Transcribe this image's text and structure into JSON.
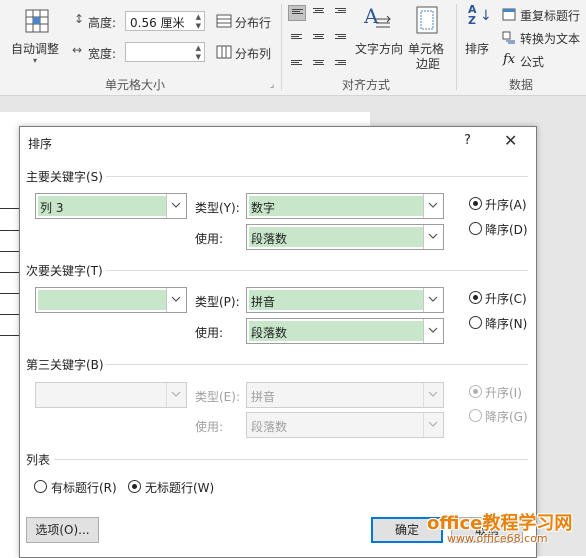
{
  "ribbon": {
    "autofit_label": "自动调整",
    "height_label": "高度:",
    "height_value": "0.56 厘米",
    "width_label": "宽度:",
    "width_value": "",
    "distribute_rows": "分布行",
    "distribute_cols": "分布列",
    "cell_size_group": "单元格大小",
    "text_direction": "文字方向",
    "cell_margins_line1": "单元格",
    "cell_margins_line2": "边距",
    "align_group": "对齐方式",
    "sort_label": "排序",
    "repeat_header": "重复标题行",
    "convert_to_text": "转换为文本",
    "formula_label": "公式",
    "data_group": "数据"
  },
  "dialog": {
    "title": "排序",
    "help": "?",
    "close": "✕",
    "primary": {
      "section": "主要关键字(S)",
      "column": "列 3",
      "type_label": "类型(Y):",
      "type_value": "数字",
      "using_label": "使用:",
      "using_value": "段落数",
      "asc": "升序(A)",
      "desc": "降序(D)",
      "selected": "asc"
    },
    "secondary": {
      "section": "次要关键字(T)",
      "column": "",
      "type_label": "类型(P):",
      "type_value": "拼音",
      "using_label": "使用:",
      "using_value": "段落数",
      "asc": "升序(C)",
      "desc": "降序(N)",
      "selected": "asc"
    },
    "tertiary": {
      "section": "第三关键字(B)",
      "column": "",
      "type_label": "类型(E):",
      "type_value": "拼音",
      "using_label": "使用:",
      "using_value": "段落数",
      "asc": "升序(I)",
      "desc": "降序(G)",
      "selected": "asc"
    },
    "list": {
      "section": "列表",
      "has_header": "有标题行(R)",
      "no_header": "无标题行(W)",
      "selected": "no_header"
    },
    "options_button": "选项(O)...",
    "ok_button": "确定",
    "cancel_button": "取消"
  },
  "watermark": {
    "line1": "office教程学习网",
    "line2": "www.office68.com"
  },
  "colors": {
    "combo_fill": "#c8e6c9",
    "default_button_border": "#0078d7",
    "watermark": "#e8820c"
  }
}
